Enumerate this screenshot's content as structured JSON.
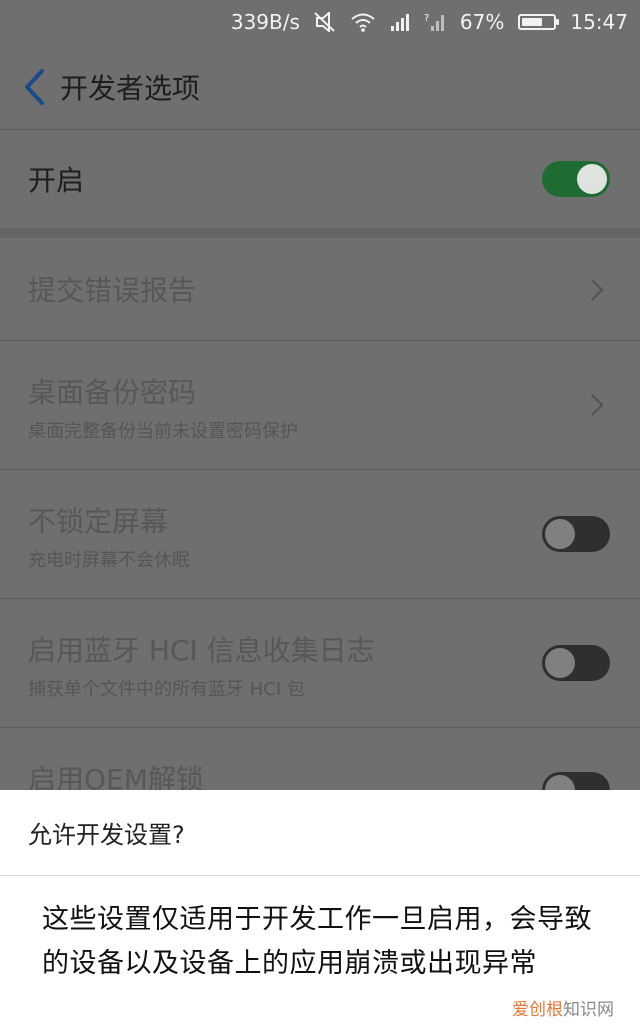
{
  "status_bar": {
    "net_speed": "339B/s",
    "battery_pct": "67%",
    "battery_level": 0.67,
    "time": "15:47",
    "icons": [
      "mute-icon",
      "wifi-icon",
      "signal-icon",
      "signal-2-icon",
      "battery-icon"
    ]
  },
  "header": {
    "title": "开发者选项",
    "back_icon": "chevron-left-icon"
  },
  "main_toggle": {
    "label": "开启",
    "state": "on"
  },
  "settings": [
    {
      "label": "提交错误报告",
      "type": "chevron"
    },
    {
      "label": "桌面备份密码",
      "subtitle": "桌面完整备份当前未设置密码保护",
      "type": "chevron"
    },
    {
      "label": "不锁定屏幕",
      "subtitle": "充电时屏幕不会休眠",
      "type": "toggle",
      "state": "off"
    },
    {
      "label": "启用蓝牙 HCI 信息收集日志",
      "subtitle": "捕获单个文件中的所有蓝牙 HCI 包",
      "type": "toggle",
      "state": "off"
    },
    {
      "label": "启用OEM解锁",
      "type": "toggle",
      "state": "off"
    }
  ],
  "dialog": {
    "title": "允许开发设置?",
    "message": "这些设置仅适用于开发工作一旦启用，会导致的设备以及设备上的应用崩溃或出现异常"
  },
  "watermark": {
    "brand": "爱创根",
    "suffix": "知识网"
  },
  "colors": {
    "accent_green": "#1f6b33",
    "back_blue": "#1a4a8a",
    "dim_overlay": "#6f6f6f"
  }
}
